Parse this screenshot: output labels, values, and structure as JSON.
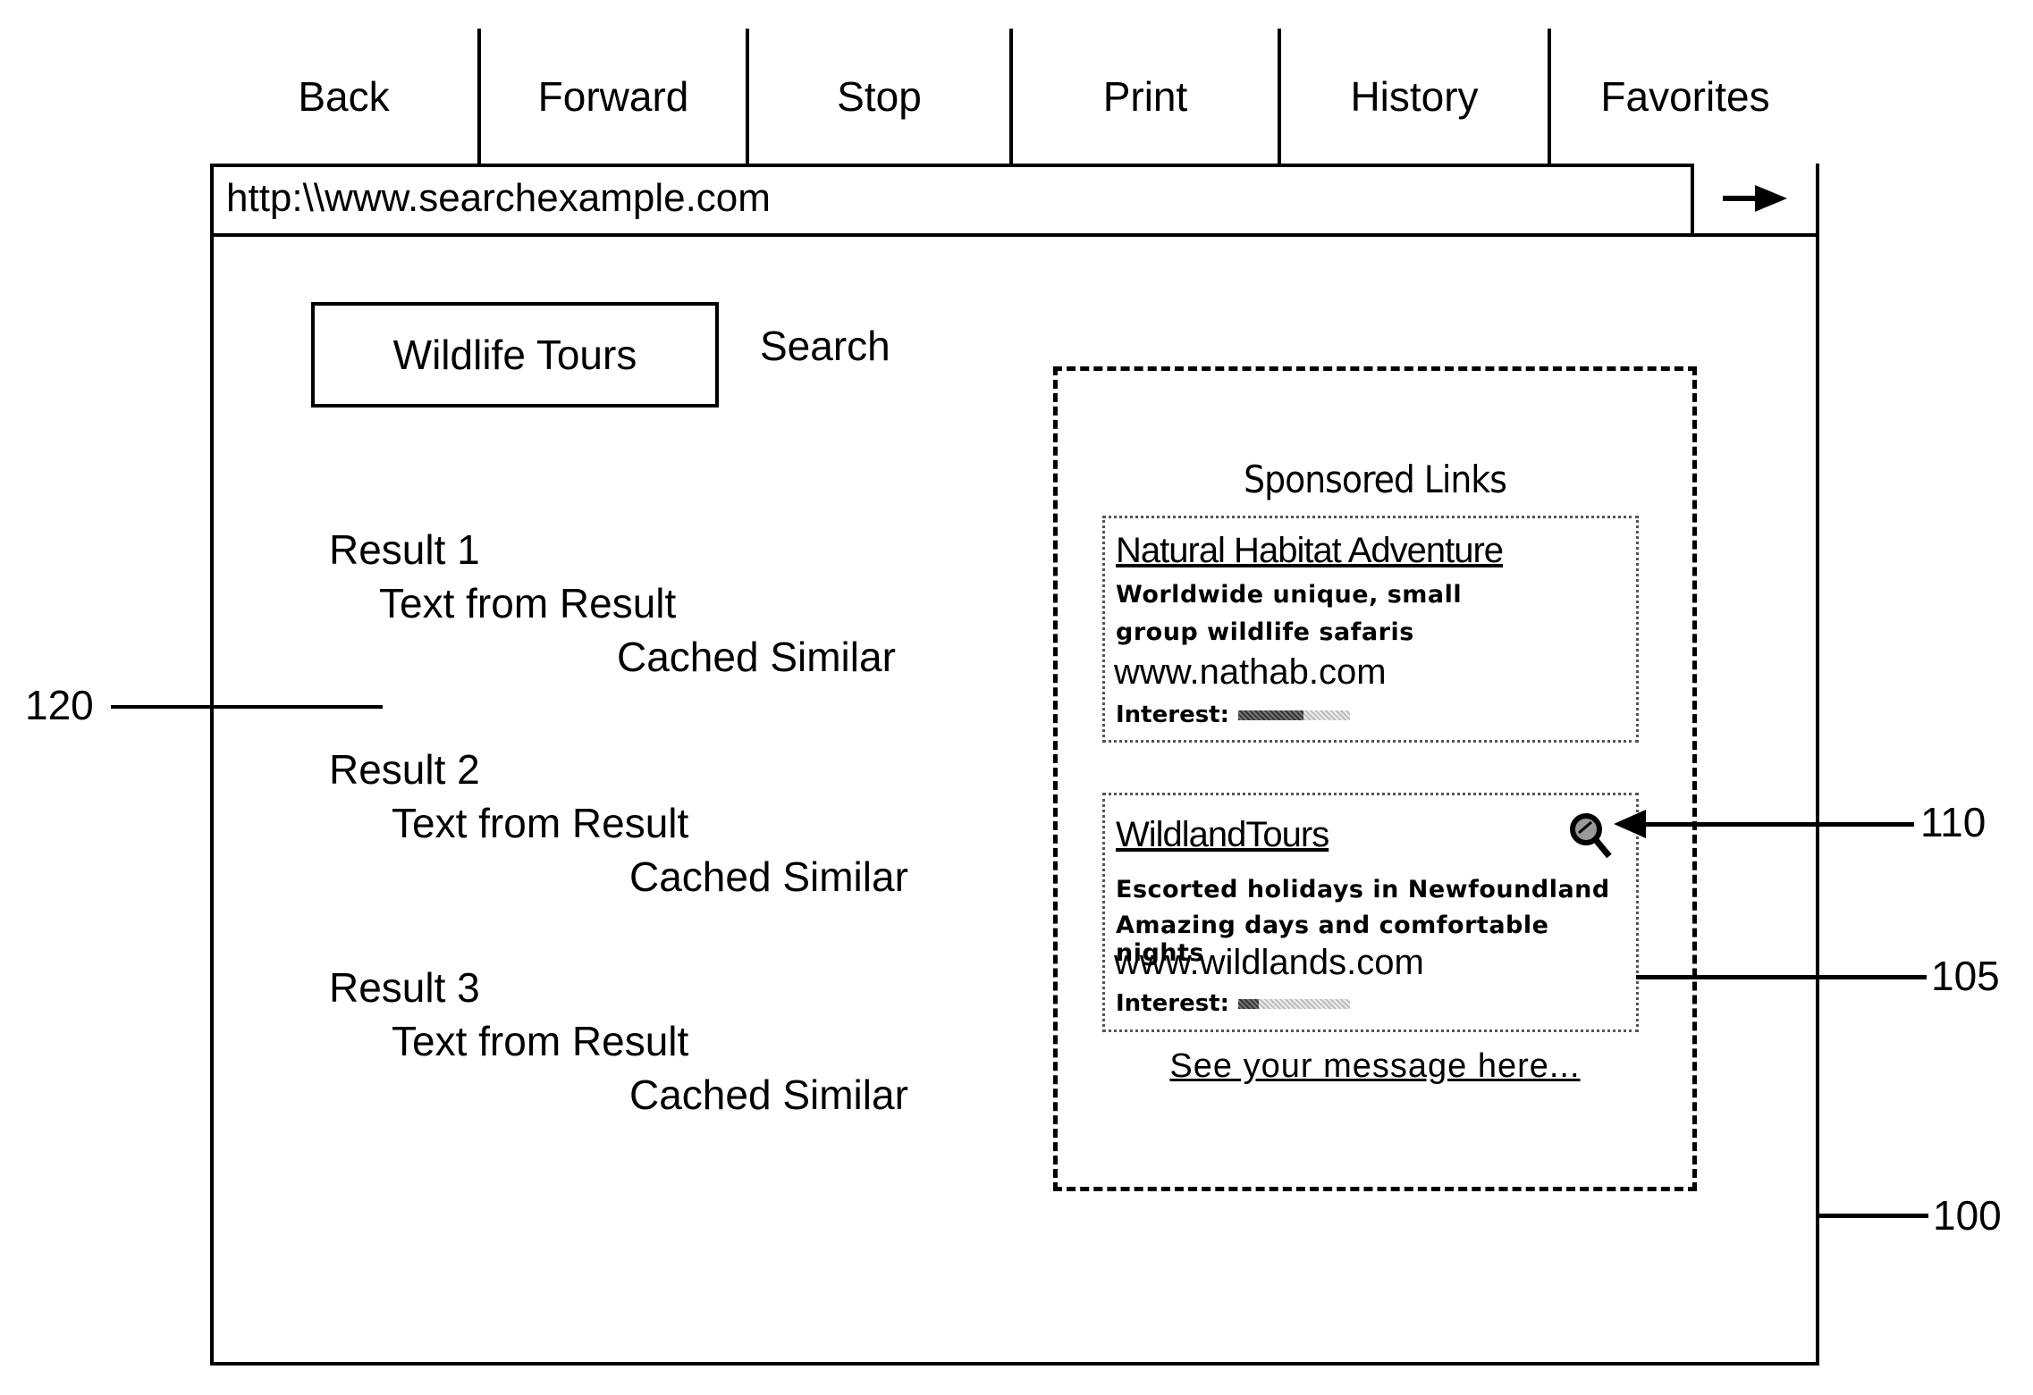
{
  "toolbar": {
    "buttons": [
      {
        "label": "Back"
      },
      {
        "label": "Forward"
      },
      {
        "label": "Stop"
      },
      {
        "label": "Print"
      },
      {
        "label": "History"
      },
      {
        "label": "Favorites"
      }
    ]
  },
  "address_bar": {
    "url": "http:\\\\www.searchexample.com",
    "go_icon": "right-arrow-icon"
  },
  "search": {
    "query": "Wildlife Tours",
    "button_label": "Search"
  },
  "results": [
    {
      "title": "Result 1",
      "text": "Text from Result",
      "links": "Cached Similar"
    },
    {
      "title": "Result 2",
      "text": "Text from Result",
      "links": "Cached Similar"
    },
    {
      "title": "Result 3",
      "text": "Text from Result",
      "links": "Cached Similar"
    }
  ],
  "sponsored": {
    "title": "Sponsored Links",
    "ads": [
      {
        "title": "Natural Habitat Adventure",
        "desc_lines": [
          "Worldwide unique, small",
          "group wildlife safaris"
        ],
        "url": "www.nathab.com",
        "interest_label": "Interest:",
        "interest_fraction": 0.58
      },
      {
        "title": "WildlandTours",
        "desc_lines": [
          "Escorted holidays in Newfoundland",
          "Amazing days and comfortable nights"
        ],
        "url": "www.wildlands.com",
        "interest_label": "Interest:",
        "interest_fraction": 0.18,
        "icon": "magnifier-icon"
      }
    ],
    "footer_link": "See your message here..."
  },
  "reference_labels": {
    "browser": "100",
    "ad": "105",
    "icon": "110",
    "results": "120"
  }
}
